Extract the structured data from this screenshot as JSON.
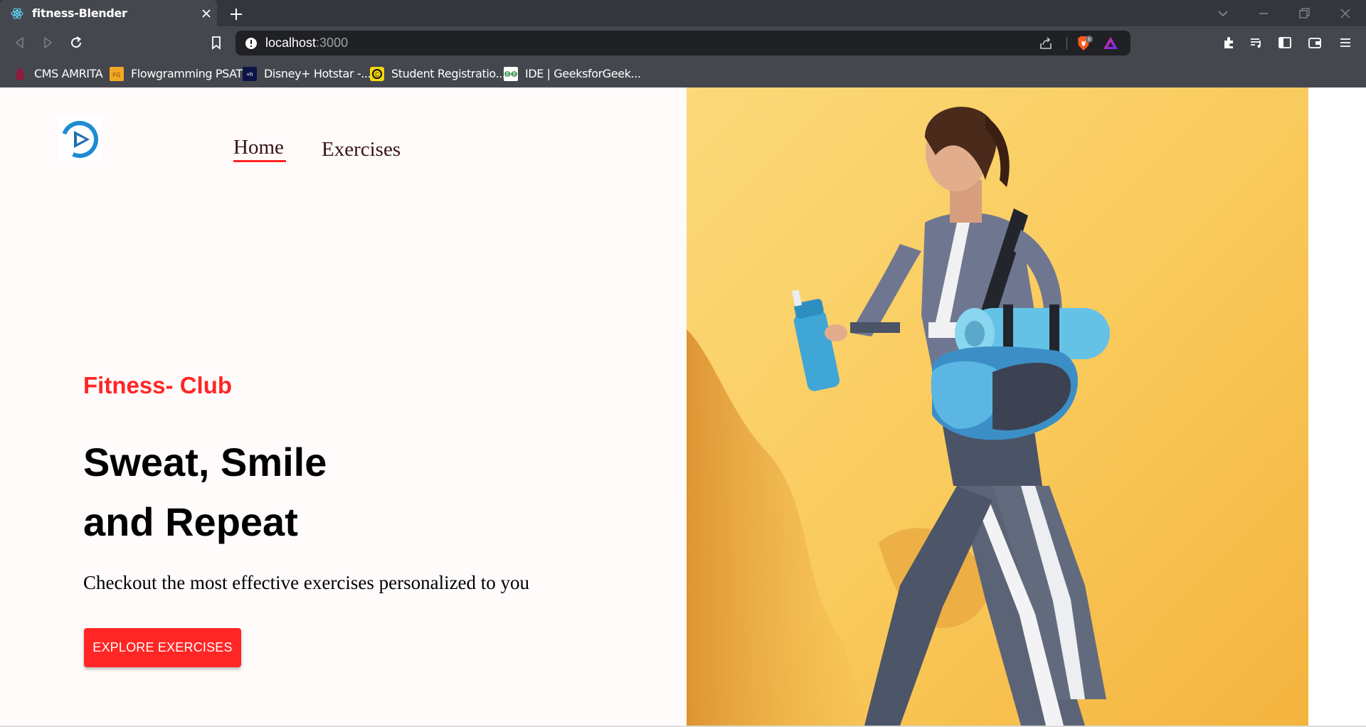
{
  "browser": {
    "tab_title": "fitness-Blender",
    "url_host": "localhost",
    "url_port": ":3000",
    "bookmarks": [
      {
        "label": "CMS AMRITA",
        "icon": "cms-amrita-icon"
      },
      {
        "label": "Flowgramming PSAT",
        "icon": "fg-icon"
      },
      {
        "label": "Disney+ Hotstar -...",
        "icon": "hotstar-icon"
      },
      {
        "label": "Student Registratio...",
        "icon": "student-registration-icon"
      },
      {
        "label": "IDE | GeeksforGeek...",
        "icon": "geeksforgeeks-icon"
      }
    ],
    "brave_shield_count": "6"
  },
  "nav": {
    "home": "Home",
    "exercises": "Exercises"
  },
  "hero": {
    "kicker": "Fitness- Club",
    "title_line1": "Sweat, Smile",
    "title_line2": "and Repeat",
    "subtitle": "Checkout the most effective exercises personalized to you",
    "button": "EXPLORE EXERCISES"
  },
  "colors": {
    "accent": "#ff2625",
    "banner_bg": "#fbc85c",
    "chrome_dark": "#34363e",
    "chrome": "#45474f"
  }
}
